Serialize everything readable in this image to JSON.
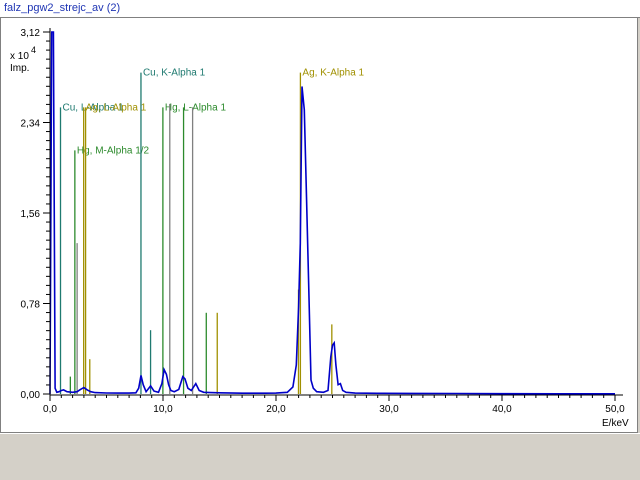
{
  "window": {
    "title": "falz_pgw2_strejc_av (2)"
  },
  "colors": {
    "spectrum": "#0000c8",
    "axis": "#000000",
    "copper": "#1f7a70",
    "silver": "#a09000",
    "mercury_l": "#2c8a2c",
    "mercury_m": "#808080"
  },
  "chart_data": {
    "type": "line",
    "title": "",
    "xlabel": "E/keV",
    "ylabel": "Imp.",
    "yscale_label": {
      "base": "x 10",
      "exponent": "4"
    },
    "xlim": [
      0,
      50
    ],
    "ylim": [
      0,
      31200
    ],
    "x_ticks": [
      {
        "value": 0,
        "label": "0,0"
      },
      {
        "value": 10,
        "label": "10,0"
      },
      {
        "value": 20,
        "label": "20,0"
      },
      {
        "value": 30,
        "label": "30,0"
      },
      {
        "value": 40,
        "label": "40,0"
      },
      {
        "value": 50,
        "label": "50,0"
      }
    ],
    "y_ticks": [
      {
        "value": 0,
        "label": "0,00"
      },
      {
        "value": 7800,
        "label": "0,78"
      },
      {
        "value": 15600,
        "label": "1,56"
      },
      {
        "value": 23400,
        "label": "2,34"
      },
      {
        "value": 31200,
        "label": "3,12"
      }
    ],
    "series": [
      {
        "values": [
          [
            0,
            0
          ],
          [
            0.15,
            31200
          ],
          [
            0.3,
            31200
          ],
          [
            0.45,
            500
          ],
          [
            0.6,
            150
          ],
          [
            0.8,
            200
          ],
          [
            1.0,
            300
          ],
          [
            1.2,
            350
          ],
          [
            1.5,
            200
          ],
          [
            2.0,
            150
          ],
          [
            2.4,
            200
          ],
          [
            2.7,
            400
          ],
          [
            3.0,
            550
          ],
          [
            3.3,
            350
          ],
          [
            3.6,
            200
          ],
          [
            4.0,
            120
          ],
          [
            5.0,
            90
          ],
          [
            6.0,
            80
          ],
          [
            7.0,
            80
          ],
          [
            7.6,
            100
          ],
          [
            7.85,
            500
          ],
          [
            8.05,
            1600
          ],
          [
            8.25,
            800
          ],
          [
            8.5,
            200
          ],
          [
            8.9,
            700
          ],
          [
            9.2,
            250
          ],
          [
            9.6,
            150
          ],
          [
            9.9,
            900
          ],
          [
            10.1,
            2100
          ],
          [
            10.3,
            1700
          ],
          [
            10.5,
            800
          ],
          [
            10.7,
            300
          ],
          [
            11.0,
            200
          ],
          [
            11.4,
            400
          ],
          [
            11.75,
            1500
          ],
          [
            11.95,
            1300
          ],
          [
            12.2,
            500
          ],
          [
            12.5,
            300
          ],
          [
            12.9,
            900
          ],
          [
            13.2,
            300
          ],
          [
            13.6,
            150
          ],
          [
            14.2,
            120
          ],
          [
            15.0,
            100
          ],
          [
            17.0,
            70
          ],
          [
            19.0,
            70
          ],
          [
            20.0,
            80
          ],
          [
            21.0,
            150
          ],
          [
            21.5,
            600
          ],
          [
            21.8,
            2500
          ],
          [
            22.0,
            7500
          ],
          [
            22.15,
            13000
          ],
          [
            22.3,
            26500
          ],
          [
            22.5,
            24500
          ],
          [
            22.7,
            17000
          ],
          [
            22.9,
            9000
          ],
          [
            23.1,
            1200
          ],
          [
            23.3,
            500
          ],
          [
            23.6,
            200
          ],
          [
            24.2,
            150
          ],
          [
            24.6,
            300
          ],
          [
            24.85,
            3200
          ],
          [
            25.0,
            4200
          ],
          [
            25.15,
            4400
          ],
          [
            25.3,
            2500
          ],
          [
            25.5,
            800
          ],
          [
            25.7,
            900
          ],
          [
            25.9,
            300
          ],
          [
            26.2,
            150
          ],
          [
            27.0,
            80
          ],
          [
            29.0,
            60
          ],
          [
            32.0,
            50
          ],
          [
            36.0,
            40
          ],
          [
            40.0,
            30
          ],
          [
            45.0,
            20
          ],
          [
            50.0,
            15
          ]
        ]
      }
    ],
    "lines": [
      {
        "label": "Cu, L-Alpha 1",
        "energy": 0.93,
        "height": 24700,
        "element": "copper",
        "labeled": true
      },
      {
        "label": "Ag, L-Alpha 1",
        "energy": 2.98,
        "height": 24700,
        "element": "silver",
        "labeled": true
      },
      {
        "label": "Hg, L-Alpha 1",
        "energy": 9.99,
        "height": 24700,
        "element": "mercury_l",
        "labeled": true
      },
      {
        "label": "Hg, M-Alpha 1/2",
        "energy": 2.2,
        "height": 21000,
        "element": "mercury_l",
        "labeled": true
      },
      {
        "label": "Cu, K-Alpha 1",
        "energy": 8.05,
        "height": 27700,
        "element": "copper",
        "labeled": true
      },
      {
        "label": "Ag, K-Alpha 1",
        "energy": 22.16,
        "height": 27700,
        "element": "silver",
        "labeled": true
      },
      {
        "energy": 3.15,
        "height": 24700,
        "element": "silver",
        "labeled": false
      },
      {
        "energy": 2.4,
        "height": 13000,
        "element": "mercury_m",
        "labeled": false
      },
      {
        "energy": 10.6,
        "height": 25000,
        "element": "mercury_m",
        "labeled": false
      },
      {
        "energy": 11.82,
        "height": 24700,
        "element": "mercury_l",
        "labeled": false
      },
      {
        "energy": 12.62,
        "height": 24700,
        "element": "mercury_m",
        "labeled": false
      },
      {
        "energy": 8.9,
        "height": 5500,
        "element": "copper",
        "labeled": false
      },
      {
        "energy": 13.83,
        "height": 7000,
        "element": "mercury_l",
        "labeled": false
      },
      {
        "energy": 14.8,
        "height": 7000,
        "element": "silver",
        "labeled": false
      },
      {
        "energy": 3.52,
        "height": 3000,
        "element": "silver",
        "labeled": false
      },
      {
        "energy": 21.99,
        "height": 9000,
        "element": "silver",
        "labeled": false
      },
      {
        "energy": 24.94,
        "height": 6000,
        "element": "silver",
        "labeled": false
      },
      {
        "energy": 1.8,
        "height": 1500,
        "element": "mercury_l",
        "labeled": false
      }
    ]
  }
}
